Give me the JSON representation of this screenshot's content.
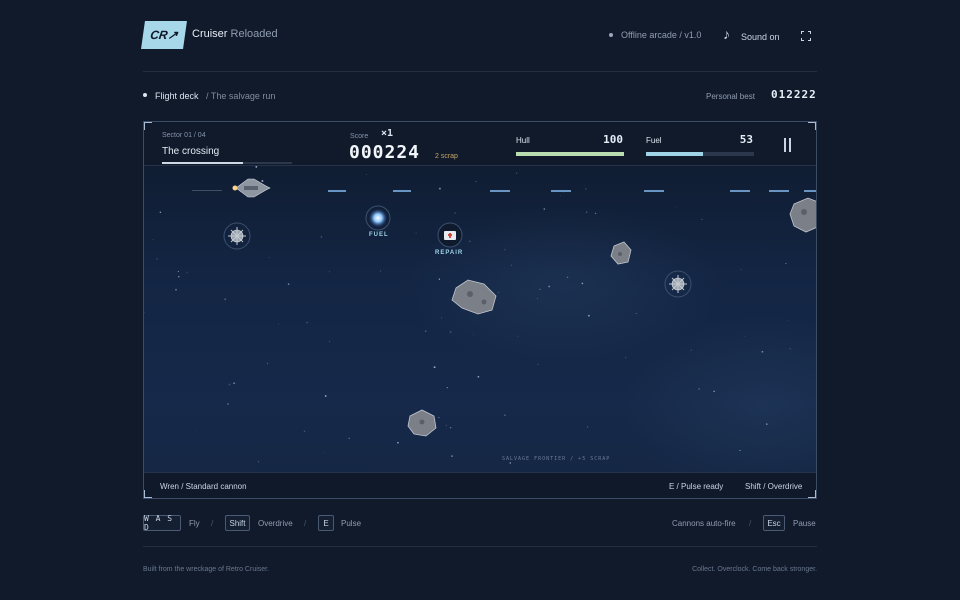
{
  "app": {
    "logo": "CR↗",
    "title": "Cruiser",
    "subtitle": "Reloaded"
  },
  "header": {
    "status": "Offline arcade / v1.0",
    "sound_label": "Sound on",
    "sound_icon": "music-note-icon",
    "fullscreen_icon": "fullscreen-icon"
  },
  "breadcrumb": {
    "current": "Flight deck",
    "trail": "/ The salvage run"
  },
  "personal_best": {
    "label": "Personal best",
    "value": "012222"
  },
  "hud": {
    "sector_label": "Sector 01 / 04",
    "sector_name": "The crossing",
    "sector_progress": 0.62,
    "score_label": "Score",
    "multiplier": "×1",
    "score": "000224",
    "scrap": "2 scrap",
    "hull_label": "Hull",
    "hull_value": "100",
    "hull_percent": 100,
    "fuel_label": "Fuel",
    "fuel_value": "53",
    "fuel_percent": 53
  },
  "playfield": {
    "pickups": [
      {
        "kind": "fuel",
        "label": "FUEL",
        "color": "#9fd3e8"
      },
      {
        "kind": "repair",
        "label": "REPAIR",
        "color": "#9fd3e8"
      }
    ],
    "caption": "SALVAGE FRONTIER / +5 SCRAP"
  },
  "game_footer": {
    "weapon": "Wren / Standard cannon",
    "pulse": "E / Pulse ready",
    "overdrive": "Shift / Overdrive"
  },
  "controls": {
    "move_key": "W A S D",
    "move_label": "Fly",
    "overdrive_key": "Shift",
    "overdrive_label": "Overdrive",
    "pulse_key": "E",
    "pulse_label": "Pulse",
    "autofire_label": "Cannons auto-fire",
    "pause_key": "Esc",
    "pause_label": "Pause"
  },
  "footer": {
    "left": "Built from the wreckage of Retro Cruiser.",
    "right": "Collect. Overclock. Come back stronger."
  },
  "colors": {
    "background": "#111a2a",
    "accent": "#a7d8ea",
    "hull": "#b9dcb1",
    "fuel": "#9fd3e8",
    "scrap": "#c7a664"
  }
}
